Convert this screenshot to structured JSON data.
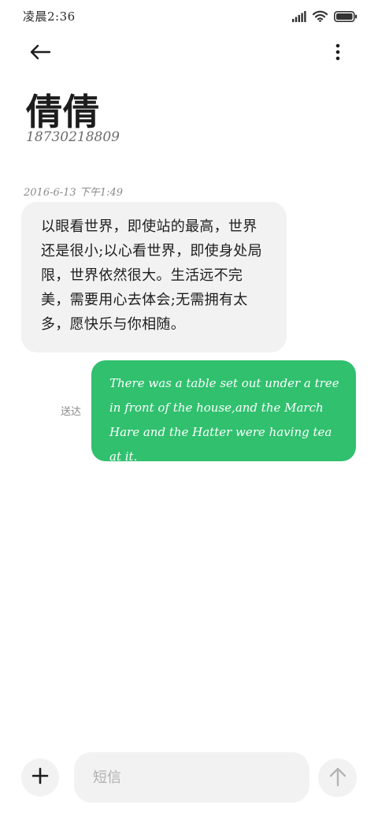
{
  "status_bar": {
    "time": "凌晨2:36",
    "icons": [
      "signal-icon",
      "wifi-icon",
      "battery-icon"
    ]
  },
  "toolbar": {
    "back_icon": "arrow-left-icon",
    "more_icon": "more-vertical-icon"
  },
  "contact": {
    "name": "倩倩",
    "number": "18730218809"
  },
  "conversation": {
    "timestamp": "2016-6-13 下午1:49",
    "messages": [
      {
        "direction": "incoming",
        "text": "以眼看世界，即使站的最高，世界还是很小;以心看世界，即使身处局限，世界依然很大。生活远不完美，需要用心去体会;无需拥有太多，愿快乐与你相随。"
      },
      {
        "direction": "outgoing",
        "status": "送达",
        "text": "There was a table set out under a tree in front of the house,and the March Hare and the Hatter were having tea at it."
      }
    ]
  },
  "composer": {
    "placeholder": "短信",
    "value": "",
    "add_icon": "plus-icon",
    "send_icon": "arrow-up-icon"
  },
  "colors": {
    "outgoing_bubble": "#30c06e",
    "incoming_bubble": "#f2f2f2",
    "background": "#ffffff"
  }
}
